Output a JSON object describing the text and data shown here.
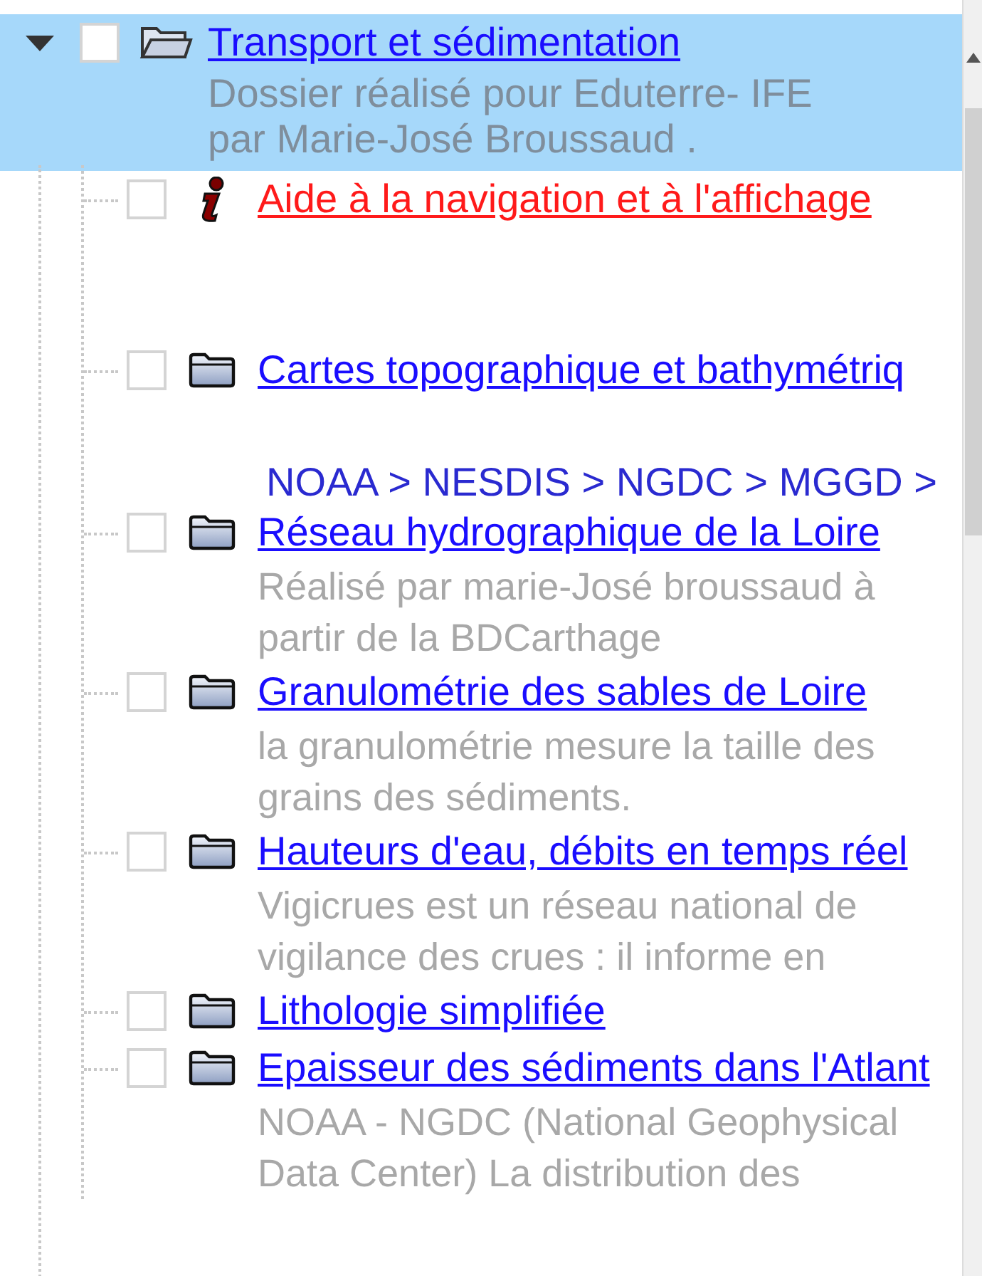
{
  "tree": {
    "title": "Transport et sédimentation",
    "expanded": true,
    "selected": true,
    "checked": false,
    "description": [
      "Dossier réalisé pour Eduterre- IFE",
      "par Marie-José Broussaud ."
    ],
    "children": [
      {
        "kind": "info",
        "title": "Aide à la navigation et à l'affichage",
        "checked": false,
        "selected": false
      },
      {
        "kind": "folder",
        "title": "Cartes topographique et bathymétriq",
        "checked": false,
        "selected": false,
        "breadcrumb": "NOAA > NESDIS > NGDC > MGGD >"
      },
      {
        "kind": "folder",
        "title": "Réseau hydrographique de la Loire",
        "checked": false,
        "selected": false,
        "description": [
          "Réalisé par marie-José broussaud à",
          "partir de la BDCarthage"
        ]
      },
      {
        "kind": "folder",
        "title": "Granulométrie des sables de Loire",
        "checked": false,
        "selected": false,
        "description": [
          "la granulométrie mesure la taille des",
          "grains des sédiments."
        ]
      },
      {
        "kind": "folder",
        "title": "Hauteurs d'eau, débits en temps réel",
        "checked": false,
        "selected": false,
        "description": [
          "Vigicrues est un réseau national de",
          "vigilance des crues : il informe en"
        ]
      },
      {
        "kind": "folder",
        "title": "Lithologie simplifiée",
        "checked": false,
        "selected": false
      },
      {
        "kind": "folder",
        "title": "Epaisseur des sédiments dans l'Atlant",
        "checked": false,
        "selected": false,
        "description": [
          "NOAA - NGDC (National Geophysical",
          "Data Center) La distribution des"
        ]
      }
    ]
  }
}
